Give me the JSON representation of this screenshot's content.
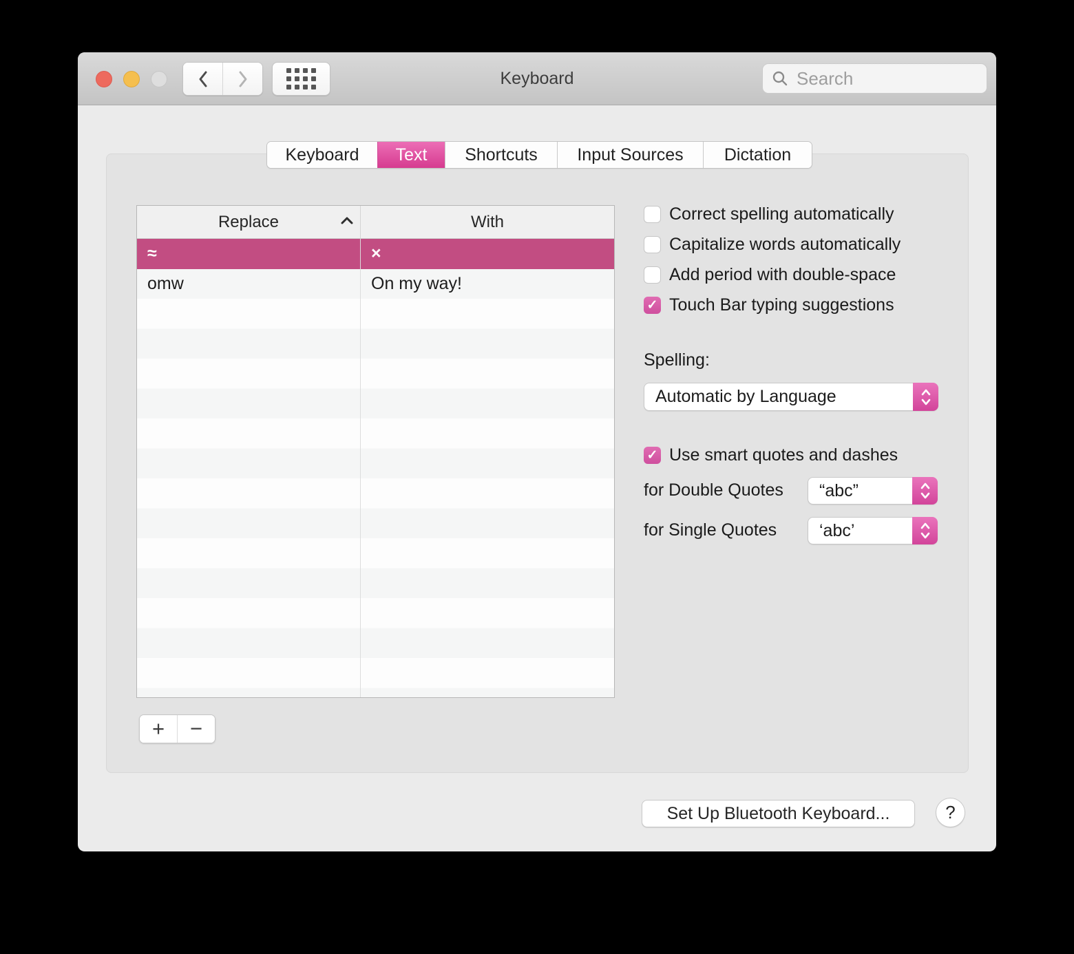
{
  "window": {
    "title": "Keyboard"
  },
  "titlebar": {
    "search_placeholder": "Search",
    "traffic_lights": [
      "close",
      "minimize",
      "zoom"
    ]
  },
  "tabs": [
    {
      "label": "Keyboard",
      "selected": false
    },
    {
      "label": "Text",
      "selected": true
    },
    {
      "label": "Shortcuts",
      "selected": false
    },
    {
      "label": "Input Sources",
      "selected": false
    },
    {
      "label": "Dictation",
      "selected": false
    }
  ],
  "table": {
    "columns": [
      {
        "label": "Replace",
        "sorted": "ascending"
      },
      {
        "label": "With",
        "sorted": "none"
      }
    ],
    "rows": [
      {
        "replace": "≈",
        "with": "×",
        "selected": true
      },
      {
        "replace": "omw",
        "with": "On my way!",
        "selected": false
      }
    ]
  },
  "controls": {
    "add_label": "+",
    "remove_label": "−",
    "checkboxes": [
      {
        "label": "Correct spelling automatically",
        "checked": false
      },
      {
        "label": "Capitalize words automatically",
        "checked": false
      },
      {
        "label": "Add period with double-space",
        "checked": false
      },
      {
        "label": "Touch Bar typing suggestions",
        "checked": true
      }
    ],
    "spelling": {
      "label": "Spelling:",
      "value": "Automatic by Language"
    },
    "smart_quotes": {
      "label": "Use smart quotes and dashes",
      "checked": true
    },
    "double_quotes": {
      "label": "for Double Quotes",
      "value": "“abc”"
    },
    "single_quotes": {
      "label": "for Single Quotes",
      "value": "‘abc’"
    }
  },
  "footer": {
    "setup_button": "Set Up Bluetooth Keyboard...",
    "help_button": "?"
  },
  "icons": {
    "check": "✓"
  },
  "colors": {
    "accent_pink": "#d63b90",
    "selected_row_pink": "#c24d82",
    "checkbox_pink": "#cf4f9e",
    "titlebar_gradient_top": "#d9d9d9",
    "titlebar_gradient_bottom": "#c4c4c4",
    "pane_background": "#e3e3e3",
    "window_background": "#ebebeb"
  }
}
